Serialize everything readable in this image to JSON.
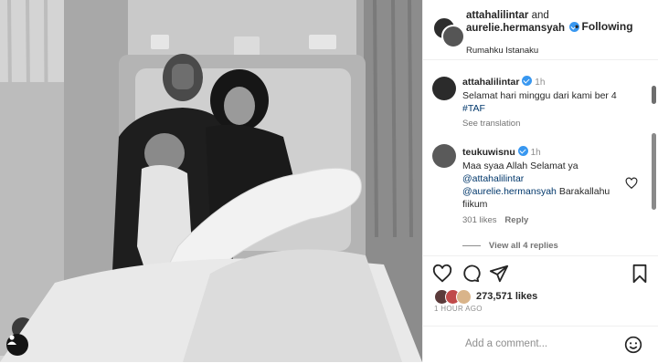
{
  "post": {
    "author_primary": "attahalilintar",
    "joiner": "and",
    "author_secondary": "aurelie.hermansyah",
    "follow_separator": "•",
    "follow_label": "Following",
    "location": "Rumahku Istanaku"
  },
  "caption": {
    "username": "attahalilintar",
    "time": "1h",
    "text": "Selamat hari minggu dari kami ber 4",
    "hashtag": "#TAF",
    "translate": "See translation"
  },
  "comment": {
    "username": "teukuwisnu",
    "time": "1h",
    "text_1": "Maa syaa Allah Selamat ya",
    "mention_1": "@attahalilintar",
    "mention_2": "@aurelie.hermansyah",
    "text_2": "Barakallahu fiikum",
    "likes": "301 likes",
    "reply": "Reply",
    "view_replies": "View all 4 replies"
  },
  "engagement": {
    "likes_count": "273,571 likes",
    "posted_ago": "1 HOUR AGO"
  },
  "composer": {
    "placeholder": "Add a comment..."
  },
  "icons": [
    "user-tag-icon",
    "verified-icon",
    "more-options-icon",
    "heart-icon",
    "comment-icon",
    "share-icon",
    "save-icon",
    "emoji-icon"
  ]
}
